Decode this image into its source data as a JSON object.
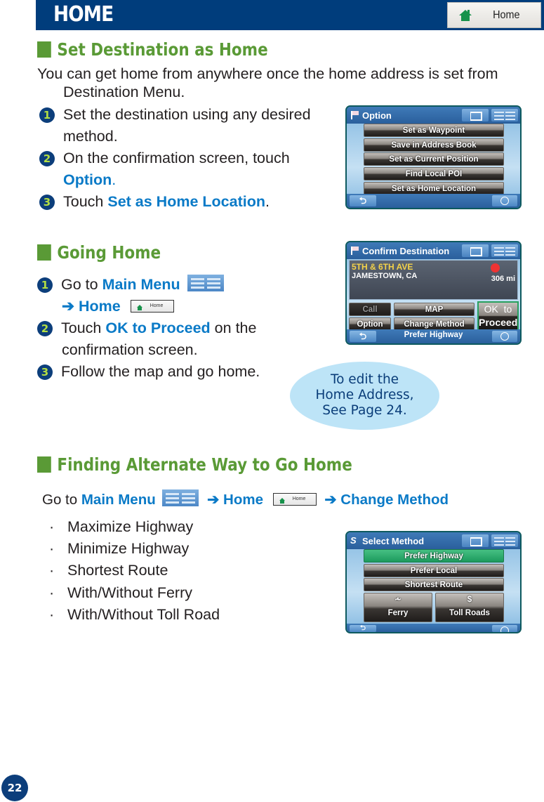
{
  "header": {
    "title": "HOME",
    "home_button_label": "Home"
  },
  "section1": {
    "heading": "Set Destination as Home",
    "intro_line1": "You can get home from anywhere once the home address is set from",
    "intro_line2": "Destination Menu.",
    "steps": [
      {
        "num": "1",
        "text": "Set the destination using any desired",
        "text2": "method."
      },
      {
        "num": "2",
        "text": "On the confirmation screen, touch",
        "highlight": "Option",
        "suffix": "."
      },
      {
        "num": "3",
        "prefix": "Touch ",
        "highlight": "Set as Home Location",
        "suffix": "."
      }
    ],
    "device": {
      "title": "Option",
      "buttons": [
        "Set as Waypoint",
        "Save in Address Book",
        "Set as Current Position",
        "Find Local POI",
        "Set as Home Location"
      ],
      "back_glyph": "⮌"
    }
  },
  "section2": {
    "heading": "Going Home",
    "steps": [
      {
        "num": "1",
        "prefix": "Go to ",
        "highlight": "Main Menu",
        "line2_arrow": "➔ Home",
        "mini_home": "Home"
      },
      {
        "num": "2",
        "prefix": "Touch ",
        "highlight": "OK to Proceed",
        "suffix": " on the",
        "text2": "confirmation screen."
      },
      {
        "num": "3",
        "text": "Follow the map and go home."
      }
    ],
    "device": {
      "title": "Confirm Destination",
      "address_line1": "5TH & 6TH AVE",
      "address_line2": "JAMESTOWN, CA",
      "distance": "306 mi",
      "buttons": {
        "call": "Call",
        "map": "MAP",
        "ok_line1": "OK  to",
        "ok_line2": "Proceed",
        "option": "Option",
        "change_method": "Change Method"
      },
      "footer_label": "Prefer Highway",
      "back_glyph": "⮌"
    },
    "callout": {
      "line1": "To edit the",
      "line2": "Home Address,",
      "line3": "See Page 24."
    }
  },
  "section3": {
    "heading": "Finding Alternate Way to Go Home",
    "nav": {
      "prefix": "Go to ",
      "main_menu": "Main Menu",
      "arrow_home": "➔ Home",
      "mini_home": "Home",
      "arrow_change": "➔ Change Method"
    },
    "bullets": [
      "Maximize Highway",
      "Minimize Highway",
      "Shortest Route",
      "With/Without Ferry",
      "With/Without Toll Road"
    ],
    "bullet_glyph": "·",
    "device": {
      "title": "Select Method",
      "buttons": [
        "Prefer Highway",
        "Prefer Local",
        "Shortest Route"
      ],
      "ferry_label": "Ferry",
      "ferry_glyph": "⩪",
      "toll_label": "Toll Roads",
      "toll_glyph": "$",
      "back_glyph": "⮌"
    }
  },
  "page_number": "22",
  "colors": {
    "header_bg": "#003d7c",
    "section_heading": "#5a9a36",
    "highlight_blue": "#0a7ac7",
    "step_circle": "#0c3e7b",
    "step_digit": "#b3de43",
    "callout_bg": "#bde4f7"
  }
}
